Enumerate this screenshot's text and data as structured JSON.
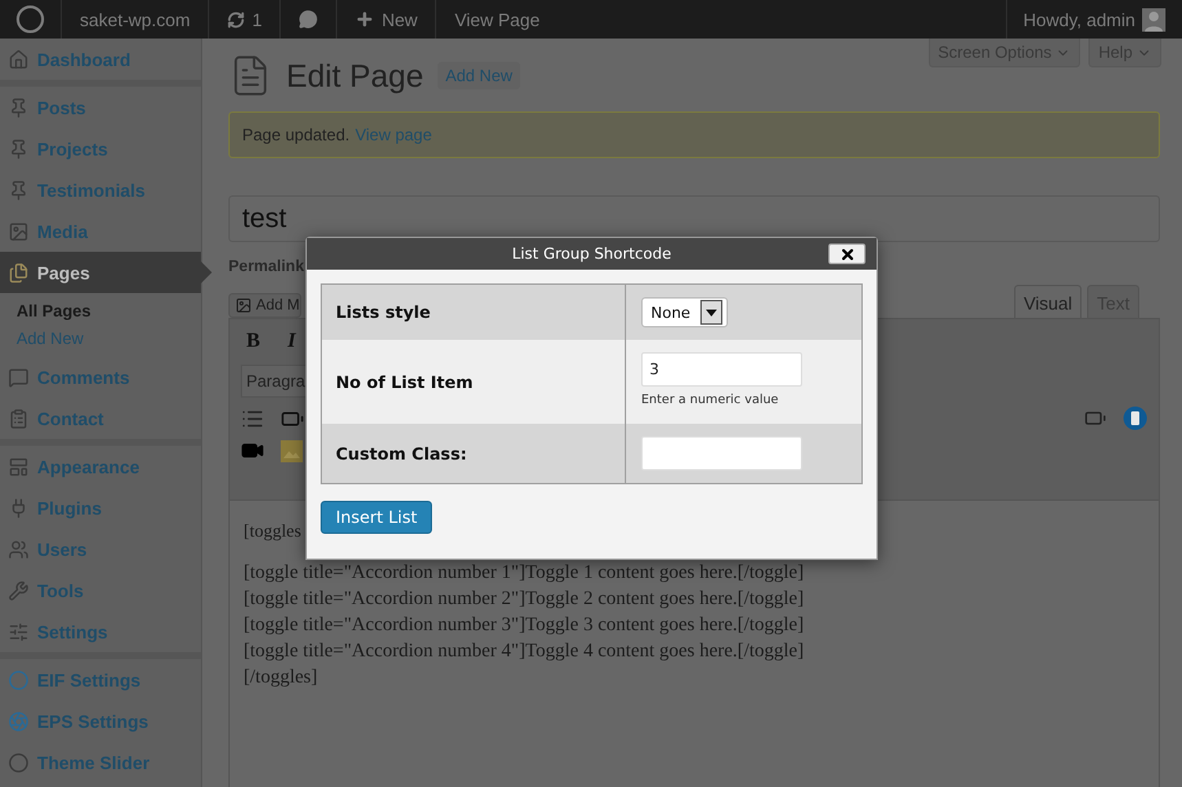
{
  "admin_bar": {
    "site": "saket-wp.com",
    "updates": "1",
    "new_label": "New",
    "view_label": "View Page",
    "greeting": "Howdy, admin"
  },
  "sidebar": {
    "groups": [
      [
        {
          "label": "Dashboard",
          "selected": false
        }
      ],
      [
        {
          "label": "Posts",
          "selected": false
        },
        {
          "label": "Projects",
          "selected": false
        },
        {
          "label": "Testimonials",
          "selected": false
        },
        {
          "label": "Media",
          "selected": false
        },
        {
          "label": "Pages",
          "selected": true,
          "children": [
            {
              "label": "All Pages",
              "selected": true
            },
            {
              "label": "Add New",
              "selected": false
            }
          ]
        },
        {
          "label": "Comments",
          "selected": false
        },
        {
          "label": "Contact",
          "selected": false
        }
      ],
      [
        {
          "label": "Appearance",
          "selected": false
        },
        {
          "label": "Plugins",
          "selected": false
        },
        {
          "label": "Users",
          "selected": false
        },
        {
          "label": "Tools",
          "selected": false
        },
        {
          "label": "Settings",
          "selected": false
        }
      ],
      [
        {
          "label": "EIF Settings",
          "selected": false
        },
        {
          "label": "EPS Settings",
          "selected": false
        },
        {
          "label": "Theme Slider",
          "selected": false
        }
      ]
    ]
  },
  "header": {
    "screen_options": "Screen Options",
    "help": "Help",
    "title": "Edit Page",
    "add_new": "Add New"
  },
  "notice": {
    "text": "Page updated.",
    "link": "View page"
  },
  "post_title": "test",
  "permalink_label": "Permalink",
  "add_media": "Add M",
  "editor": {
    "tabs": [
      {
        "label": "Visual",
        "selected": true
      },
      {
        "label": "Text",
        "selected": false
      }
    ],
    "bold": "B",
    "italic": "I",
    "format": "Paragra",
    "lines": [
      "[toggles",
      "[toggle title=\"Accordion number 1\"]Toggle 1 content goes here.[/toggle]",
      "[toggle title=\"Accordion number 2\"]Toggle 2 content goes here.[/toggle]",
      "[toggle title=\"Accordion number 3\"]Toggle 3 content goes here.[/toggle]",
      "[toggle title=\"Accordion number 4\"]Toggle 4 content goes here.[/toggle]",
      "[/toggles]"
    ]
  },
  "dialog": {
    "title": "List Group Shortcode",
    "fields": [
      {
        "kind": "select",
        "label": "Lists style",
        "value": "None"
      },
      {
        "kind": "text",
        "label": "No of List Item",
        "value": "3",
        "hint": "Enter a numeric value"
      },
      {
        "kind": "text",
        "label": "Custom Class:"
      }
    ],
    "button": "Insert List"
  }
}
